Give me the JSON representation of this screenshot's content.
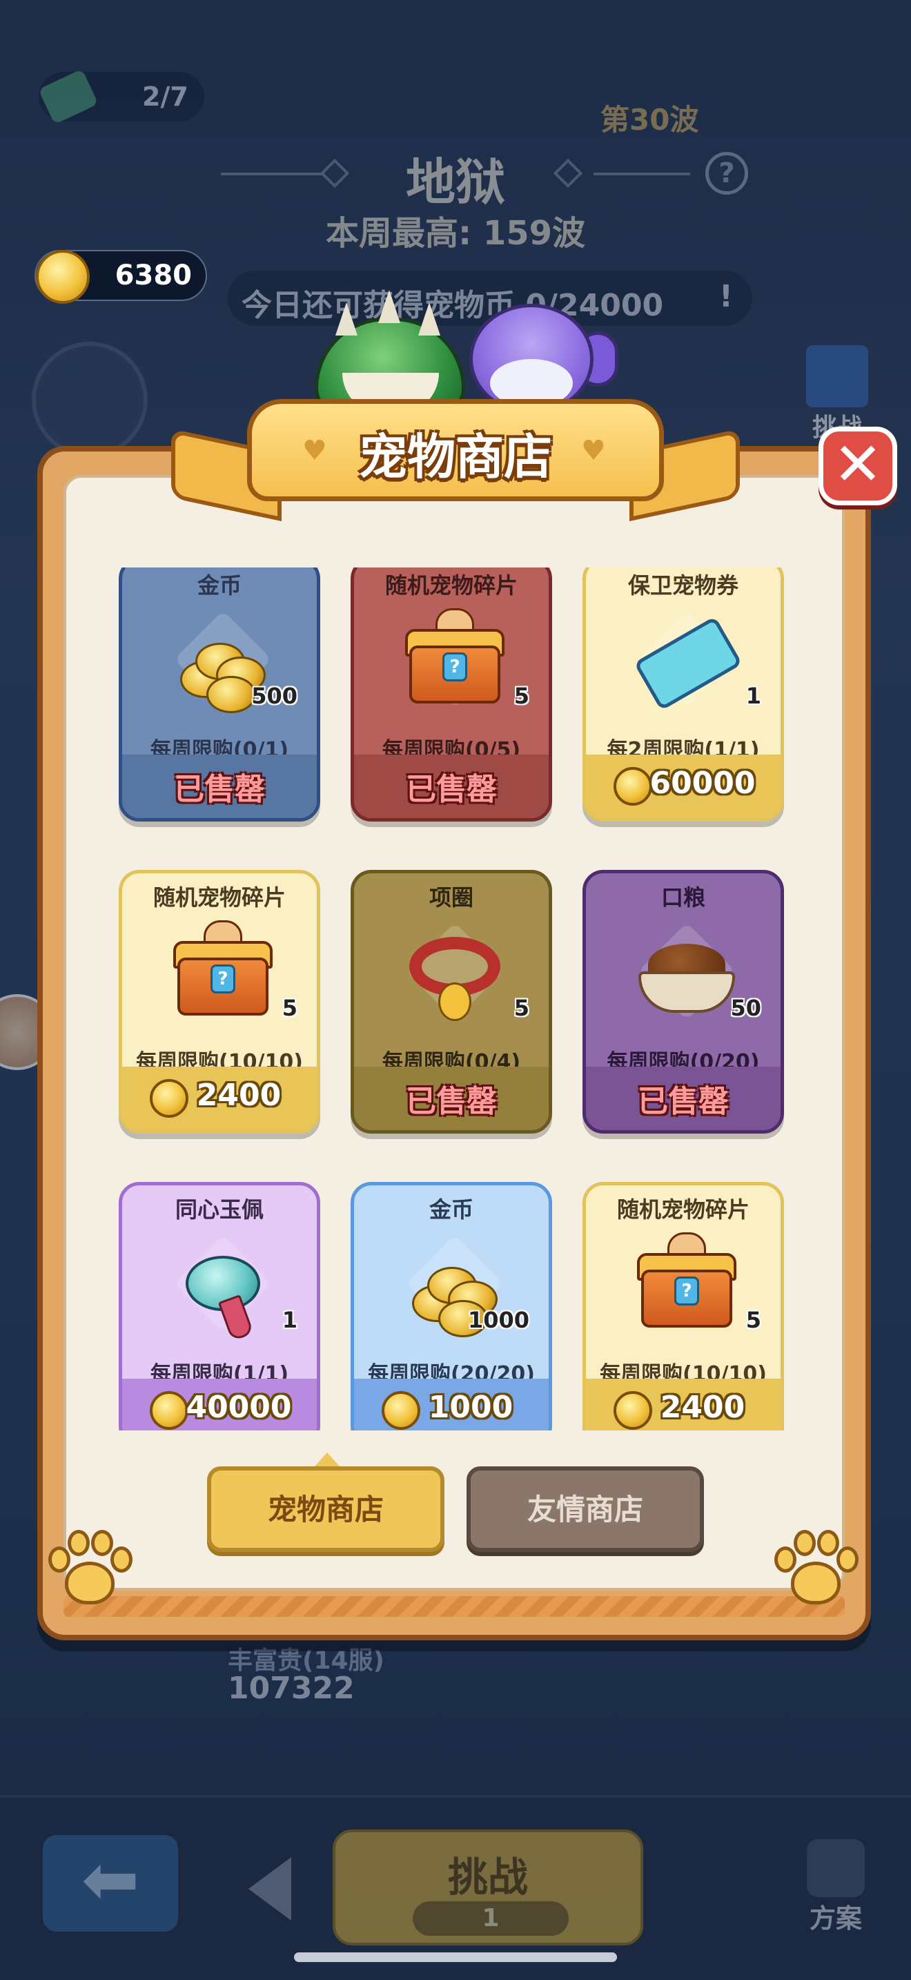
{
  "background": {
    "ticket_count": "2/7",
    "wave_label": "第30波",
    "mode_title": "地狱",
    "weekly_best": "本周最高: 159波",
    "coin_balance": "6380",
    "daily_pet_coin": "今日还可获得宠物币 0/24000",
    "warn_glyph": "!",
    "help_glyph": "?",
    "challenge_side_label": "挑战",
    "player_name": "丰富贵(14服)",
    "power_value": "107322",
    "back_glyph": "⬅",
    "challenge_button_label": "挑战",
    "challenge_cost": "1",
    "plan_label": "方案"
  },
  "shop": {
    "title": "宠物商店",
    "close_glyph": "✕",
    "sold_out_label": "已售罄",
    "items": [
      {
        "name": "金币",
        "qty": "500",
        "limit": "每周限购(0/1)",
        "price": "",
        "sold_out": true,
        "theme": "blue",
        "icon": "coin-pile-icon"
      },
      {
        "name": "随机宠物碎片",
        "qty": "5",
        "limit": "每周限购(0/5)",
        "price": "",
        "sold_out": true,
        "theme": "red",
        "icon": "pet-chest-icon"
      },
      {
        "name": "保卫宠物券",
        "qty": "1",
        "limit": "每2周限购(1/1)",
        "price": "60000",
        "sold_out": false,
        "theme": "yellow",
        "icon": "pet-ticket-icon"
      },
      {
        "name": "随机宠物碎片",
        "qty": "5",
        "limit": "每周限购(10/10)",
        "price": "2400",
        "sold_out": false,
        "theme": "yellow",
        "icon": "pet-chest-icon"
      },
      {
        "name": "项圈",
        "qty": "5",
        "limit": "每周限购(0/4)",
        "price": "",
        "sold_out": true,
        "theme": "olive",
        "icon": "collar-icon"
      },
      {
        "name": "口粮",
        "qty": "50",
        "limit": "每周限购(0/20)",
        "price": "",
        "sold_out": true,
        "theme": "purple",
        "icon": "food-bowl-icon"
      },
      {
        "name": "同心玉佩",
        "qty": "1",
        "limit": "每周限购(1/1)",
        "price": "40000",
        "sold_out": false,
        "theme": "lilac",
        "icon": "jade-pendant-icon"
      },
      {
        "name": "金币",
        "qty": "1000",
        "limit": "每周限购(20/20)",
        "price": "1000",
        "sold_out": false,
        "theme": "sky",
        "icon": "coin-pile-icon"
      },
      {
        "name": "随机宠物碎片",
        "qty": "5",
        "limit": "每周限购(10/10)",
        "price": "2400",
        "sold_out": false,
        "theme": "yellow",
        "icon": "pet-chest-icon"
      }
    ],
    "tabs": [
      {
        "label": "宠物商店",
        "active": true
      },
      {
        "label": "友情商店",
        "active": false
      }
    ]
  }
}
